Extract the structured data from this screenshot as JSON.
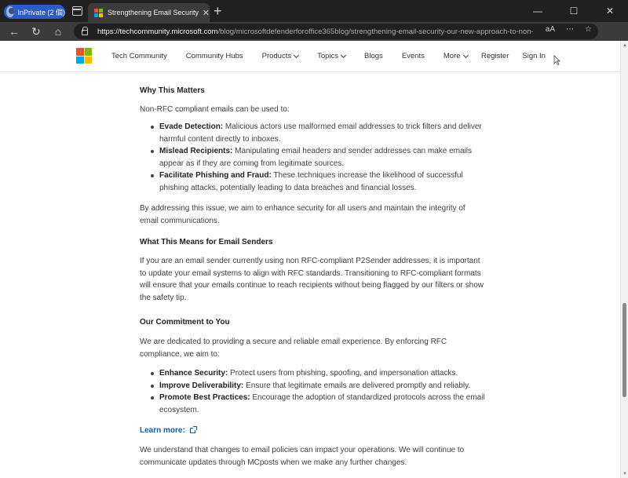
{
  "browser": {
    "profile_label": "InPrivate (2 個)",
    "tab_title": "Strengthening Email Security: Ou",
    "tab_close": "✕",
    "new_tab": "+",
    "window_controls": {
      "minimize": "—",
      "maximize": "☐",
      "close": "✕"
    },
    "url_host": "https://techcommunity.microsoft.com",
    "url_path": "/blog/microsoftdefenderforoffice365blog/strengthening-email-security-our-new-approach-to-non-rf...",
    "read_aloud": "aA"
  },
  "site": {
    "brand_colors": [
      "#f25022",
      "#7fba00",
      "#00a4ef",
      "#ffb900"
    ],
    "nav": [
      "Tech Community",
      "Community Hubs",
      "Products",
      "Topics",
      "Blogs",
      "Events",
      "More"
    ],
    "register": "Register",
    "sign_in": "Sign In"
  },
  "article": {
    "why_heading": "Why This Matters",
    "why_intro": "Non-RFC compliant emails can be used to:",
    "why_items": [
      {
        "term": "Evade Detection:",
        "text": " Malicious actors use malformed email addresses to trick filters and deliver harmful content directly to inboxes."
      },
      {
        "term": "Mislead Recipients:",
        "text": " Manipulating email headers and sender addresses can make emails appear as if they are coming from legitimate sources."
      },
      {
        "term": "Facilitate Phishing and Fraud:",
        "text": " These techniques increase the likelihood of successful phishing attacks, potentially leading to data breaches and financial losses."
      }
    ],
    "addressing": "By addressing this issue, we aim to enhance security for all users and maintain the integrity of email communications.",
    "senders_heading": "What This Means for Email Senders",
    "senders_text": "If you are an email sender currently using non RFC-compliant P2Sender addresses, it is important to update your email systems to align with RFC standards. Transitioning to RFC-compliant formats will ensure that your emails continue to reach recipients without being flagged by our filters or show the safety tip.",
    "commitment_heading": "Our Commitment to You",
    "commitment_intro": "We are dedicated to providing a secure and reliable email experience. By enforcing RFC compliance, we aim to:",
    "commitment_items": [
      {
        "term": "Enhance Security:",
        "text": " Protect users from phishing, spoofing, and impersonation attacks."
      },
      {
        "term": "Improve Deliverability:",
        "text": " Ensure that legitimate emails are delivered promptly and reliably."
      },
      {
        "term": "Promote Best Practices:",
        "text": " Encourage the adoption of standardized protocols across the email ecosystem."
      }
    ],
    "learn_more": "Learn more:",
    "closing": "We understand that changes to email policies can impact your operations. We will continue to communicate updates through MCposts when we make any further changes."
  }
}
